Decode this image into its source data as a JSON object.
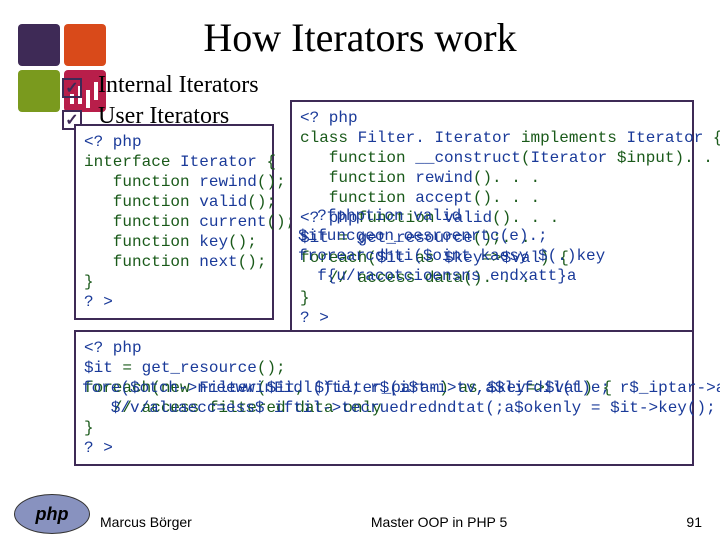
{
  "title": "How Iterators work",
  "bullets": [
    {
      "text": "Internal Iterators"
    },
    {
      "text": "User Iterators"
    }
  ],
  "code_iterator": {
    "l1": "<? php",
    "l2a": "interface",
    "l2b": "Iterator",
    "l2c": "{",
    "l3a": "   function",
    "l3b": "rewind",
    "l3c": "();",
    "l4a": "   function",
    "l4b": "valid",
    "l4c": "();",
    "l5a": "   function",
    "l5b": "current",
    "l5c": "();",
    "l6a": "   function",
    "l6b": "key",
    "l6c": "();",
    "l7a": "   function",
    "l7b": "next",
    "l7c": "();",
    "l8": "}",
    "l9": "? >"
  },
  "code_filter": {
    "l1": "<? php",
    "l2a": "class",
    "l2b": "Filter. Iterator",
    "l2c": "implements",
    "l2d": "Iterator",
    "l2e": "{",
    "l3a": "   function",
    "l3b": "__construct",
    "l3c": "(",
    "l3d": "Iterator",
    "l3e": " $input). . .",
    "l4a": "   function",
    "l4b": "rewind",
    "l4c": "(). . .",
    "l5a": "   function",
    "l5b": "accept",
    "l5c": "(). . .",
    "l6p": "<? php",
    "l6a": "function",
    "l6b": "valid",
    "l6c": "(). . .",
    "l7a": "$it",
    "l7b": "= ",
    "l7c": "get_resource",
    "l7d": "();",
    "l7e": ". .",
    "l8a": "foreach(",
    "l8b": "$it",
    "l8c": " as ",
    "l8d": "$key",
    "l8e": "=>",
    "l8f": "$val",
    "l8g": ") {",
    "l9a": "   // access data",
    "l9b": "(). . .",
    "l10": "}",
    "l11": "? >"
  },
  "overlay_filter": {
    "r6": "  ?fphption valid",
    "r7": "$ifuncgeon_oesroenrtc(e).;",
    "r7b": ". .",
    "r8": "frorearcdhti($oint kaesy $(.)key",
    "r9": "  f{u/racotcioensns endxatt}a"
  },
  "code_bottom": {
    "l1": "<? php",
    "l2a": "$it",
    "l2b": " = ",
    "l2c": "get_resource",
    "l2d": "();",
    "l3a": "foreach(new ",
    "l3b": "Filter",
    "l3c": "(",
    "l3d": "$it",
    "l3e": ", ",
    "l3f": "$filter_param",
    "l3g": ") as ",
    "l3h": "$key",
    "l3i": "=>",
    "l3j": "$val",
    "l3k": ") {",
    "l4a": "   // access filtered data only",
    "l5": "}",
    "l6": "? >"
  },
  "overlay_bottom": {
    "r3": "fore($otch->nreewwinFidl()te; r$(i$t-i>tv,a$lifdil(t)e; r$_iptar->amne)xat(s))${key",
    "r4": "   $/v/aluaecc=ess$ iftil->tecruedredndtat(;a$okenly = $it->key();"
  },
  "footer": {
    "left": "Marcus Börger",
    "center": "Master OOP in PHP 5",
    "right": "91"
  },
  "php_logo": "php"
}
